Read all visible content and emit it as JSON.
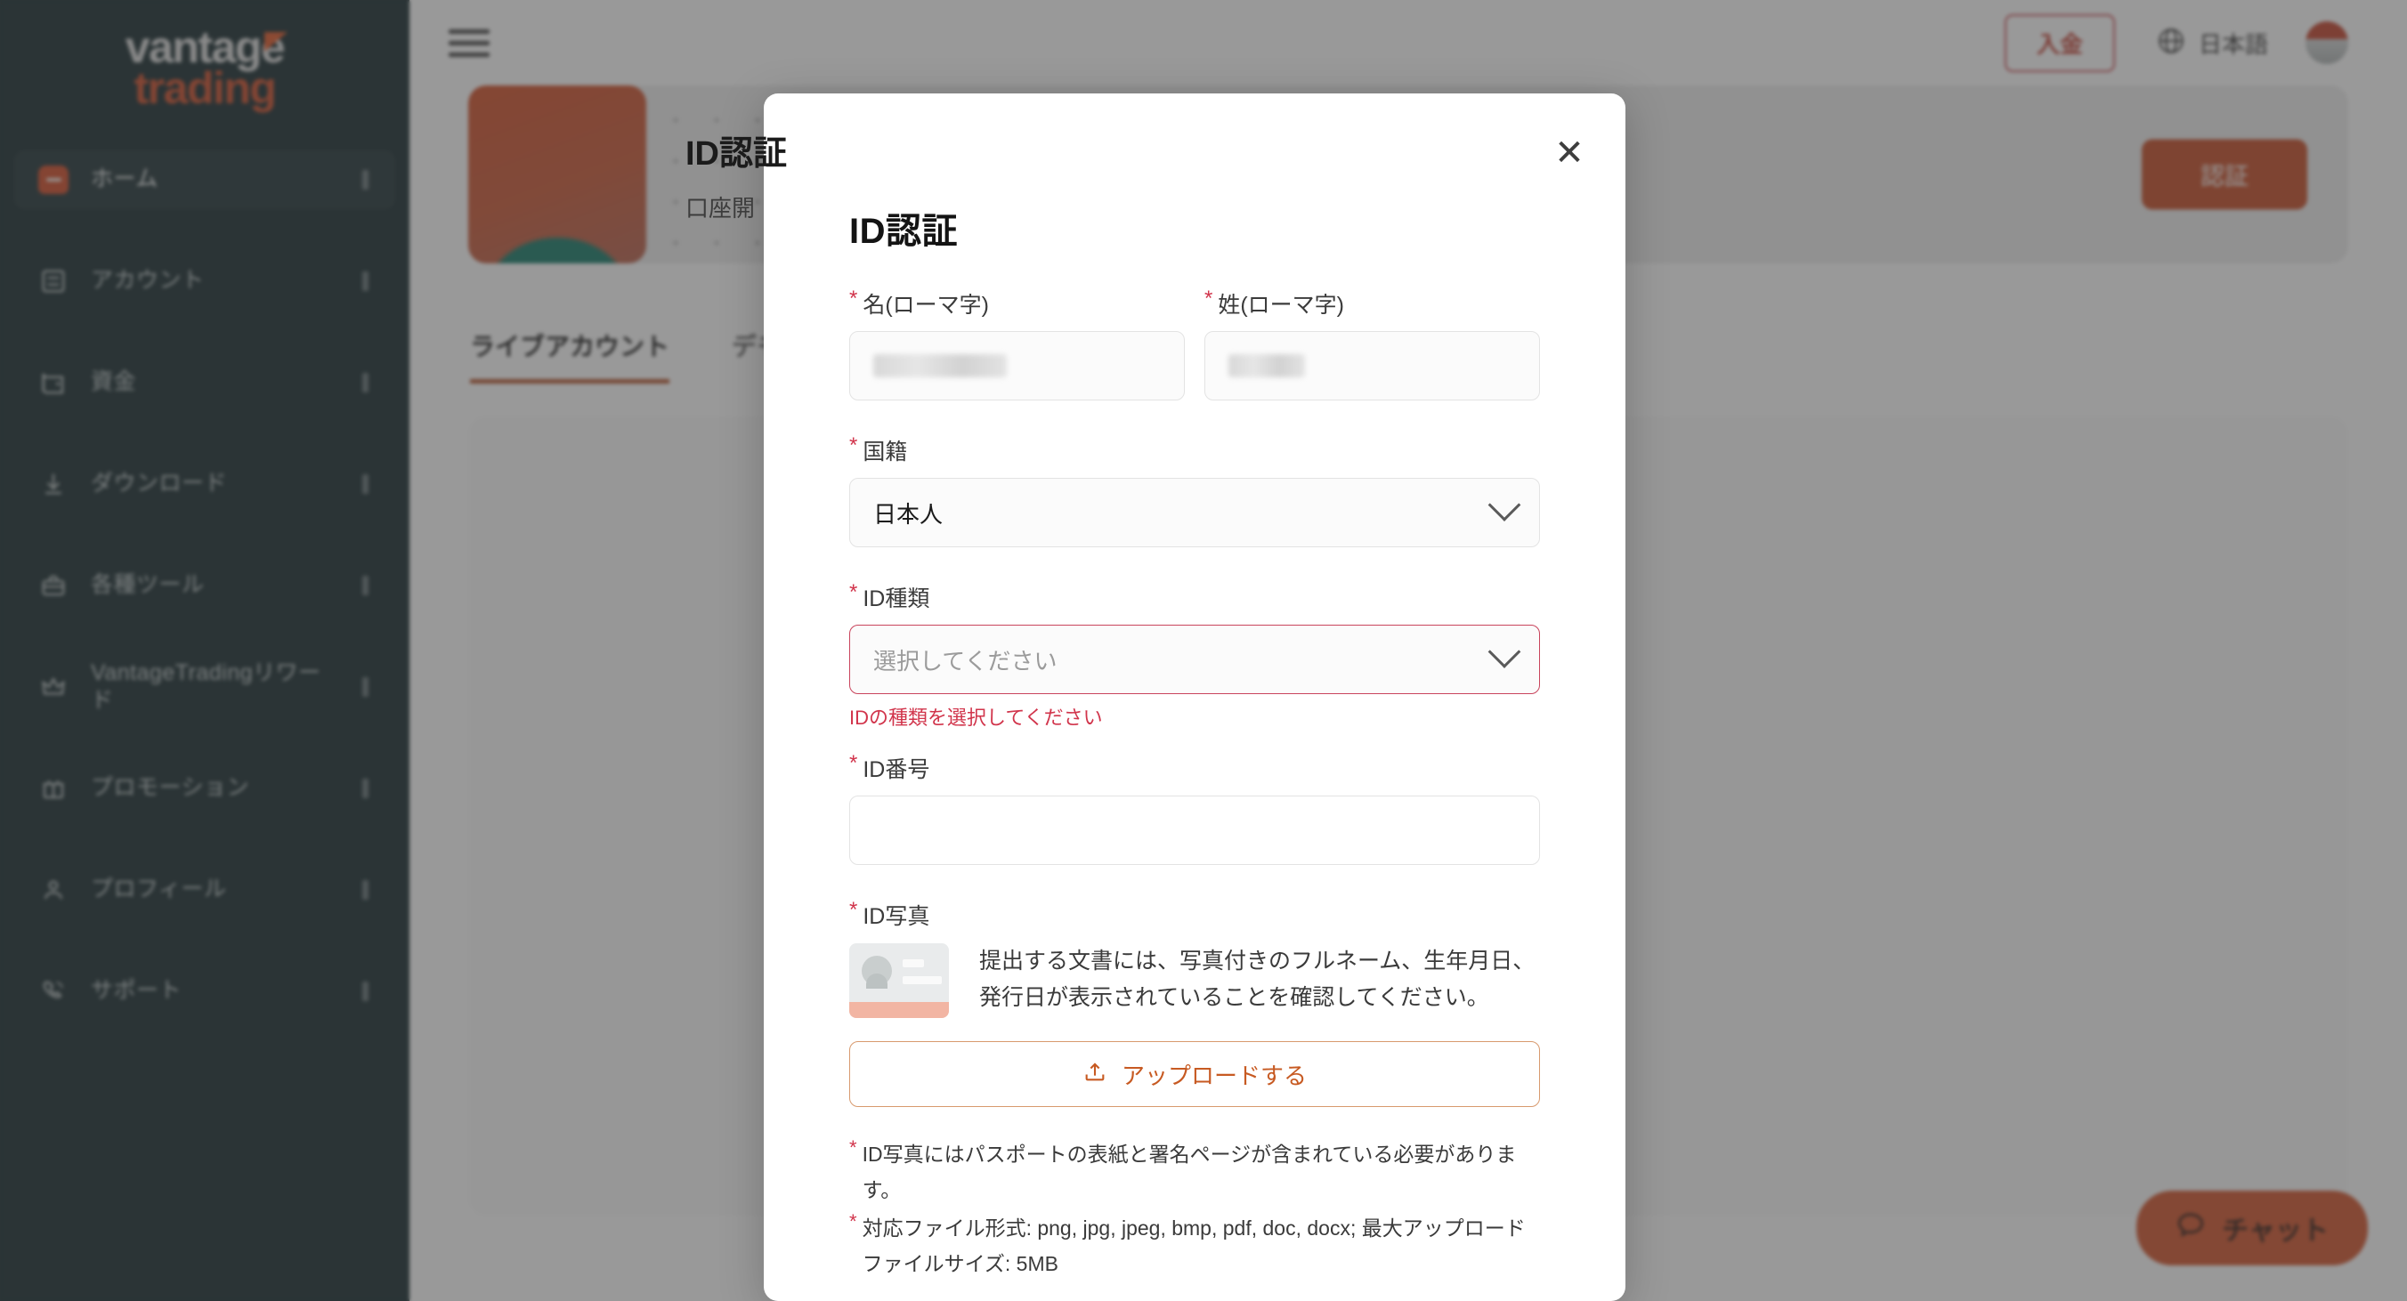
{
  "brand": {
    "logo_top": "vantage",
    "logo_bottom": "trading",
    "accent_color": "#cf4520",
    "sidebar_bg": "#0c2024"
  },
  "sidebar": {
    "items": [
      {
        "label": "ホーム",
        "icon": "home-badge-icon",
        "active": true
      },
      {
        "label": "アカウント",
        "icon": "account-icon",
        "active": false
      },
      {
        "label": "資金",
        "icon": "funds-wallet-icon",
        "active": false
      },
      {
        "label": "ダウンロード",
        "icon": "download-icon",
        "active": false
      },
      {
        "label": "各種ツール",
        "icon": "toolbox-icon",
        "active": false
      },
      {
        "label": "VantageTradingリワード",
        "icon": "crown-icon",
        "active": false
      },
      {
        "label": "プロモーション",
        "icon": "gift-icon",
        "active": false
      },
      {
        "label": "プロフィール",
        "icon": "person-icon",
        "active": false
      },
      {
        "label": "サポート",
        "icon": "phone-support-icon",
        "active": false
      }
    ]
  },
  "topbar": {
    "menu_icon": "hamburger-icon",
    "deposit_label": "入金",
    "language_icon": "globe-icon",
    "language_label": "日本語",
    "avatar_icon": "avatar"
  },
  "main": {
    "banner": {
      "title": "ID認証",
      "subtitle": "口座開",
      "cta_label": "認証"
    },
    "tabs": [
      {
        "label": "ライブアカウント",
        "active": true
      },
      {
        "label": "デモ",
        "active": false
      }
    ],
    "chat_label": "チャット",
    "chat_icon": "chat-bubble-icon"
  },
  "modal": {
    "close_icon": "close-icon",
    "close_glyph": "✕",
    "title": "ID認証",
    "required_mark": "*",
    "fields": {
      "first_name": {
        "label": "名(ローマ字)",
        "value_redacted": true,
        "placeholder": ""
      },
      "last_name": {
        "label": "姓(ローマ字)",
        "value_redacted": true,
        "placeholder": ""
      },
      "nationality": {
        "label": "国籍",
        "value": "日本人",
        "chevron_icon": "chevron-down-icon"
      },
      "id_type": {
        "label": "ID種類",
        "placeholder": "選択してください",
        "value": "",
        "error": "IDの種類を選択してください",
        "chevron_icon": "chevron-down-icon",
        "error_color": "#d1344b"
      },
      "id_number": {
        "label": "ID番号",
        "value": "",
        "placeholder": ""
      },
      "id_photo": {
        "label": "ID写真",
        "thumb_icon": "id-card-icon",
        "note": "提出する文書には、写真付きのフルネーム、生年月日、発行日が表示されていることを確認してください。",
        "upload_label": "アップロードする",
        "upload_icon": "upload-icon"
      }
    },
    "notes": [
      "ID写真にはパスポートの表紙と署名ページが含まれている必要があります。",
      "対応ファイル形式: png, jpg, jpeg, bmp, pdf, doc, docx; 最大アップロードファイルサイズ: 5MB"
    ]
  }
}
